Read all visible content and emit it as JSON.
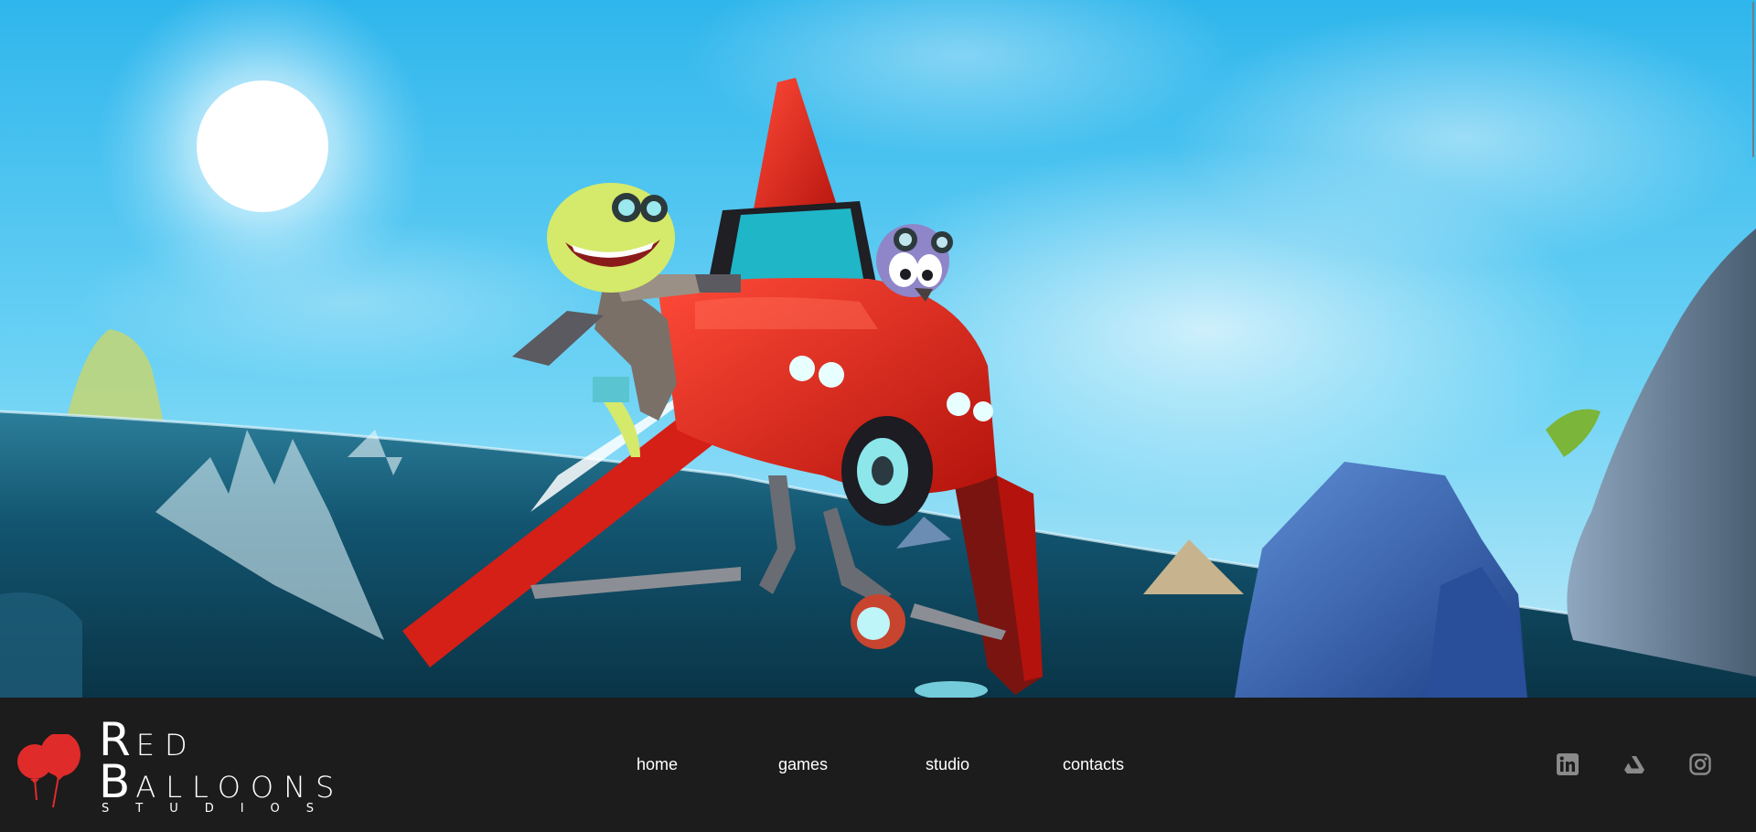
{
  "brand": {
    "line1": "Red",
    "line2": "Balloons",
    "tagline": "STUDIOS",
    "color": "#e02b2b"
  },
  "nav": {
    "items": [
      {
        "label": "home"
      },
      {
        "label": "games"
      },
      {
        "label": "studio"
      },
      {
        "label": "contacts"
      }
    ]
  },
  "social": {
    "icons": [
      "linkedin-icon",
      "artstation-icon",
      "instagram-icon"
    ],
    "color": "#8a8a8a"
  },
  "hero": {
    "sky_color": "#3fc1ef",
    "sea_color": "#0f4d66",
    "vehicle_color": "#e8281e"
  }
}
